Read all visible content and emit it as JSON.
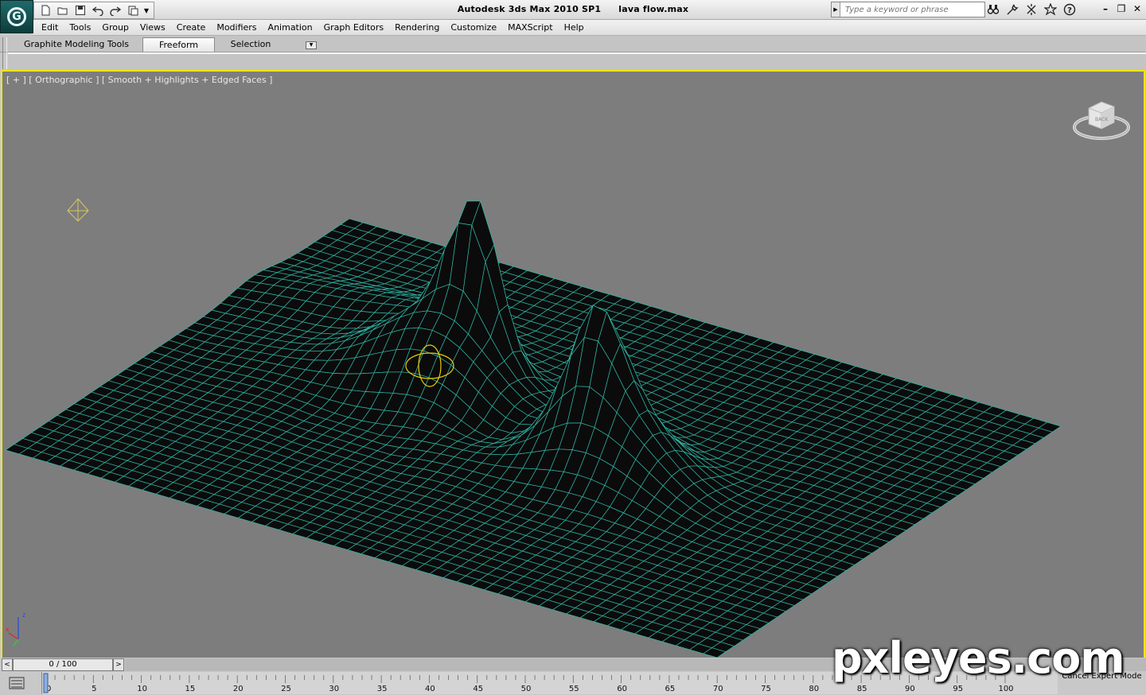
{
  "window": {
    "app_name": "Autodesk 3ds Max  2010 SP1",
    "file_name": "lava flow.max"
  },
  "search": {
    "placeholder": "Type a keyword or phrase"
  },
  "quick_access": [
    "new-file-icon",
    "open-folder-icon",
    "save-icon",
    "undo-icon",
    "redo-icon",
    "project-folder-icon"
  ],
  "info_center": [
    "binoculars-icon",
    "communication-center-icon",
    "tools-icon",
    "favorites-star-icon",
    "help-icon"
  ],
  "menu": [
    "Edit",
    "Tools",
    "Group",
    "Views",
    "Create",
    "Modifiers",
    "Animation",
    "Graph Editors",
    "Rendering",
    "Customize",
    "MAXScript",
    "Help"
  ],
  "ribbon": {
    "tabs": [
      "Graphite Modeling Tools",
      "Freeform",
      "Selection"
    ],
    "active_tab": "Freeform"
  },
  "viewport": {
    "label": "[ + ] [ Orthographic ] [ Smooth + Highlights + Edged Faces ]",
    "active_border_color": "#f2e600",
    "background_color": "#7d7d7d",
    "mesh_edge_color": "#2fb8a8",
    "mesh_face_color": "#0b0b0b",
    "viewcube_face": "BACK",
    "axis_labels": [
      "z",
      "x"
    ]
  },
  "time_slider": {
    "value": "0 / 100",
    "prev": "<",
    "next": ">"
  },
  "track_bar": {
    "labels": [
      "0",
      "5",
      "10",
      "15",
      "20",
      "25",
      "30",
      "35",
      "40",
      "45",
      "50",
      "55",
      "60",
      "65",
      "70",
      "75",
      "80",
      "85",
      "90",
      "95",
      "100"
    ]
  },
  "status": {
    "expert_mode": "Cancel Expert Mode"
  },
  "watermark": "pxleyes.com"
}
